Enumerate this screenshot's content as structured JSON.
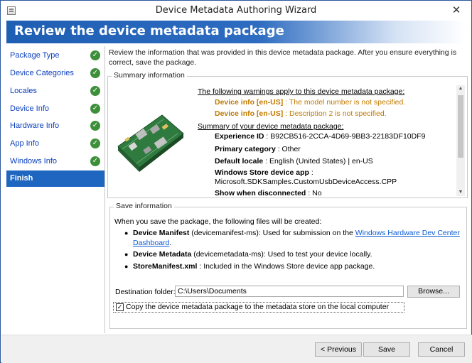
{
  "window": {
    "title": "Device Metadata Authoring Wizard",
    "close_glyph": "✕"
  },
  "header": {
    "title": "Review the device metadata package"
  },
  "sidebar": {
    "items": [
      {
        "label": "Package Type",
        "checked": true
      },
      {
        "label": "Device Categories",
        "checked": true
      },
      {
        "label": "Locales",
        "checked": true
      },
      {
        "label": "Device Info",
        "checked": true
      },
      {
        "label": "Hardware Info",
        "checked": true
      },
      {
        "label": "App Info",
        "checked": true
      },
      {
        "label": "Windows Info",
        "checked": true
      },
      {
        "label": "Finish",
        "checked": false,
        "active": true
      }
    ],
    "check_glyph": "✓"
  },
  "intro": "Review the information that was provided in this device metadata package. After you ensure everything is correct, save the package.",
  "summary": {
    "legend": "Summary information",
    "warnings_heading": "The following warnings apply to this device metadata package:",
    "warnings": [
      {
        "label": "Device info [en-US]",
        "text": " : The model number is not specified."
      },
      {
        "label": "Device info [en-US]",
        "text": " : Description 2 is not specified."
      }
    ],
    "summary_heading": "Summary of your device metadata package:",
    "experience_id": {
      "label": "Experience ID",
      "value": " : B92CB516-2CCA-4D69-9BB3-22183DF10DF9"
    },
    "primary_category": {
      "label": "Primary category",
      "value": " : Other"
    },
    "default_locale": {
      "label": "Default locale",
      "value": " : English (United States) | en-US"
    },
    "store_app": {
      "label": "Windows Store device app",
      "value": " :",
      "value2": "Microsoft.SDKSamples.CustomUsbDeviceAccess.CPP"
    },
    "show_disconnected": {
      "label": "Show when disconnected",
      "value": " : No"
    }
  },
  "save": {
    "legend": "Save information",
    "intro": "When you save the package, the following files will be created:",
    "files": [
      {
        "name": "Device Manifest",
        "desc": " (devicemanifest-ms): Used for submission on the ",
        "link": "Windows Hardware Dev Center",
        "link2": "Dashboard",
        "tail": "."
      },
      {
        "name": "Device Metadata",
        "desc": " (devicemetadata-ms): Used to test your device locally."
      },
      {
        "name": "StoreManifest.xml",
        "desc": " : Included in the Windows Store device app package."
      }
    ],
    "destination_label": "Destination folder:",
    "required_mark": "*",
    "destination_value": "C:\\Users\\Documents",
    "browse_label": "Browse...",
    "copy_label": "Copy the device metadata package to the metadata store on the local computer",
    "copy_checked": true
  },
  "footer": {
    "previous_label": "< Previous",
    "save_label": "Save",
    "cancel_label": "Cancel"
  },
  "colors": {
    "accent": "#1f66c1",
    "warning": "#c07a00",
    "check": "#3d8f3a",
    "link": "#0a5bd3"
  }
}
